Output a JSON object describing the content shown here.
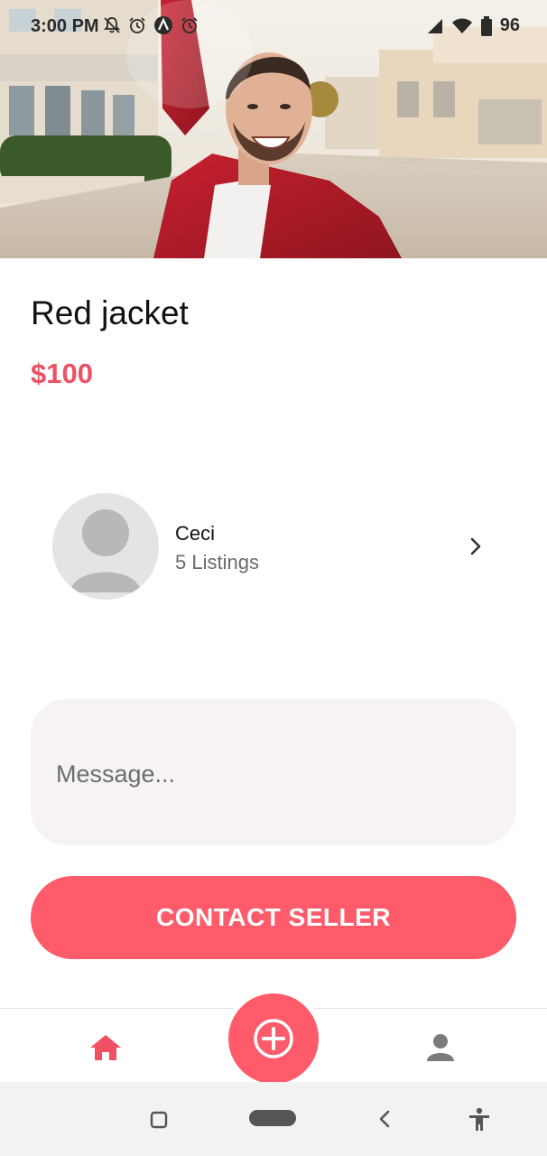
{
  "status_bar": {
    "time": "3:00 PM",
    "battery": "96",
    "icons": [
      "notifications-off-icon",
      "alarm-icon",
      "app-a-icon",
      "alarm-icon",
      "signal-icon",
      "wifi-icon",
      "battery-icon"
    ]
  },
  "product": {
    "image_icon": "product-photo",
    "title": "Red jacket",
    "price": "$100"
  },
  "seller": {
    "name": "Ceci",
    "listings": "5 Listings",
    "avatar_icon": "avatar-placeholder-icon",
    "chevron_icon": "chevron-right-icon"
  },
  "message": {
    "placeholder": "Message..."
  },
  "contact_button": {
    "label": "CONTACT SELLER"
  },
  "bottom_nav": {
    "items": [
      "home-icon",
      "add-icon",
      "profile-icon"
    ]
  },
  "colors": {
    "accent": "#ff5b6a",
    "price": "#ef5064",
    "message_bg": "#f6f3f2",
    "text": "#111111",
    "muted": "#6a6a6a"
  }
}
